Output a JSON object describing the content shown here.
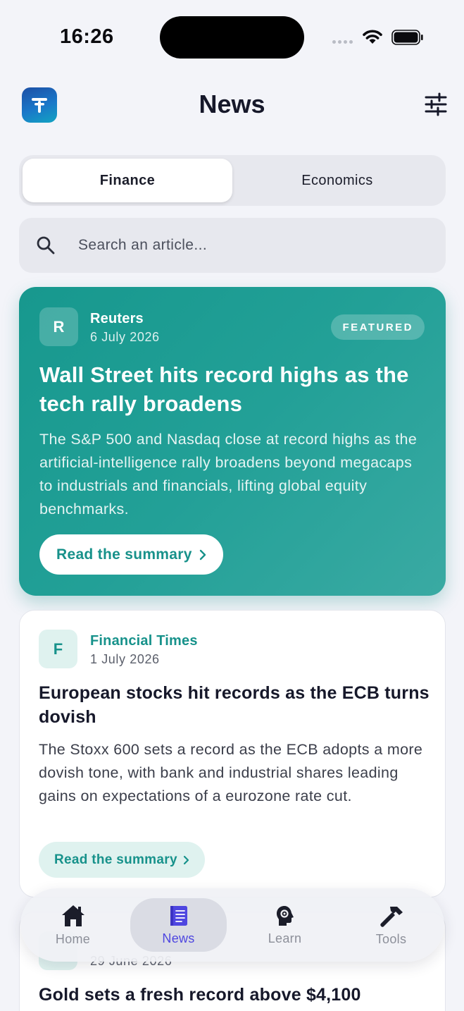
{
  "status_bar": {
    "time": "16:26"
  },
  "header": {
    "title": "News",
    "logo_letter": "T"
  },
  "tabs": [
    {
      "label": "Finance",
      "selected": true
    },
    {
      "label": "Economics",
      "selected": false
    }
  ],
  "search": {
    "placeholder": "Search an article...",
    "value": ""
  },
  "featured": {
    "source_initial": "R",
    "source": "Reuters",
    "date": "6 July 2026",
    "badge": "FEATURED",
    "title": "Wall Street hits record highs as the tech rally broadens",
    "summary": "The S&P 500 and Nasdaq close at record highs as the artificial-intelligence rally broadens beyond megacaps to industrials and financials, lifting global equity benchmarks.",
    "button_label": "Read the summary"
  },
  "articles": [
    {
      "source_initial": "F",
      "source": "Financial Times",
      "date": "1 July 2026",
      "title": "European stocks hit records as the ECB turns dovish",
      "summary": "The Stoxx 600 sets a record as the ECB adopts a more dovish tone, with bank and industrial shares leading gains on expectations of a eurozone rate cut.",
      "button_label": "Read the summary"
    },
    {
      "date": "29 June 2026",
      "title": "Gold sets a fresh record above $4,100"
    }
  ],
  "nav": [
    {
      "label": "Home",
      "icon": "home-icon",
      "active": false
    },
    {
      "label": "News",
      "icon": "news-icon",
      "active": true
    },
    {
      "label": "Learn",
      "icon": "learn-icon",
      "active": false
    },
    {
      "label": "Tools",
      "icon": "hammer-icon",
      "active": false
    }
  ],
  "colors": {
    "accent_teal": "#17988e",
    "nav_active": "#4e46e0",
    "background": "#f3f4f9"
  }
}
